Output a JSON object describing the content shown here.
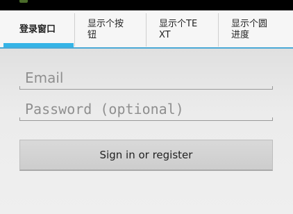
{
  "tabs": [
    {
      "label": "登录窗口",
      "active": true
    },
    {
      "label": "显示个按钮",
      "active": false
    },
    {
      "label": "显示个TEXT",
      "active": false
    },
    {
      "label": "显示个圆进度",
      "active": false
    }
  ],
  "form": {
    "email_placeholder": "Email",
    "password_placeholder": "Password (optional)",
    "email_value": "",
    "password_value": ""
  },
  "signin_button": {
    "label": "Sign in or register"
  },
  "colors": {
    "tab_indicator": "#35b4e6",
    "tab_underline": "#4aa9d6"
  }
}
